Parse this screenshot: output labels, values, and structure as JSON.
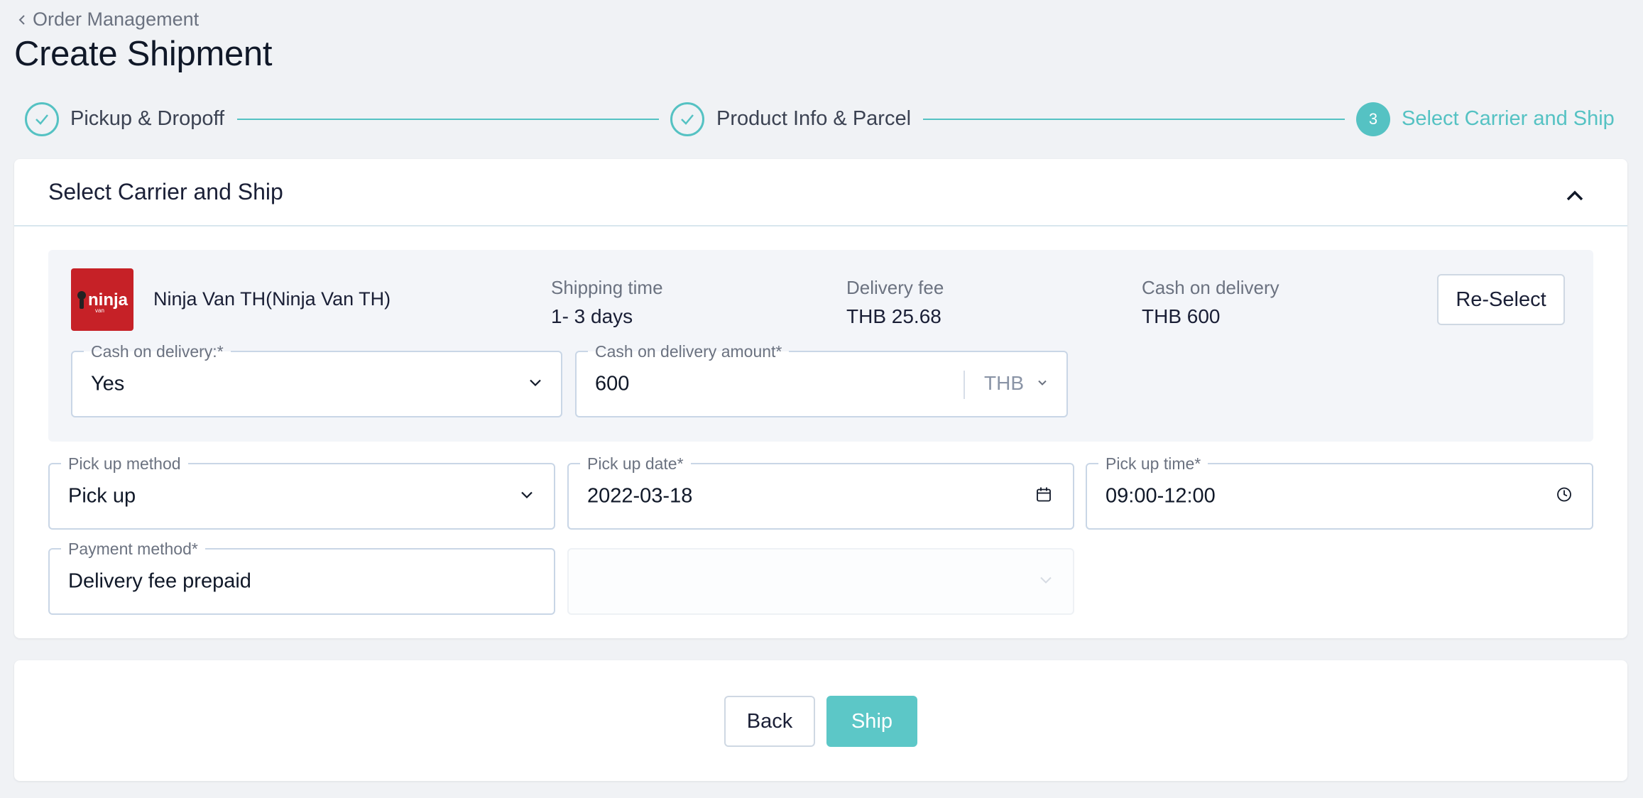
{
  "header": {
    "breadcrumb": "Order Management",
    "title": "Create Shipment"
  },
  "stepper": {
    "steps": [
      {
        "label": "Pickup & Dropoff",
        "state": "done"
      },
      {
        "label": "Product Info & Parcel",
        "state": "done"
      },
      {
        "label": "Select Carrier and Ship",
        "state": "active",
        "number": "3"
      }
    ]
  },
  "carrier_section": {
    "title": "Select Carrier and Ship",
    "carrier": {
      "logo_text": "ninja",
      "logo_subtext": "van",
      "name": "Ninja Van TH(Ninja Van TH)",
      "shipping_time_label": "Shipping time",
      "shipping_time_value": "1- 3 days",
      "delivery_fee_label": "Delivery fee",
      "delivery_fee_value": "THB 25.68",
      "cod_label": "Cash on delivery",
      "cod_value": "THB 600",
      "reselect_label": "Re-Select"
    },
    "cod_field": {
      "label": "Cash on delivery:",
      "required_mark": "*",
      "value": "Yes"
    },
    "cod_amount_field": {
      "label": "Cash on delivery amount",
      "required_mark": "*",
      "value": "600",
      "currency": "THB"
    },
    "pickup_method_field": {
      "label": "Pick up method",
      "value": "Pick up"
    },
    "pickup_date_field": {
      "label": "Pick up date",
      "required_mark": "*",
      "value": "2022-03-18"
    },
    "pickup_time_field": {
      "label": "Pick up time",
      "required_mark": "*",
      "value": "09:00-12:00"
    },
    "payment_method_field": {
      "label": "Payment method",
      "required_mark": "*",
      "value": "Delivery fee prepaid"
    }
  },
  "actions": {
    "back_label": "Back",
    "ship_label": "Ship"
  },
  "colors": {
    "accent": "#55c2c3",
    "ship_button": "#5cc7c7",
    "logo_red": "#c62127",
    "background": "#f0f2f5"
  }
}
